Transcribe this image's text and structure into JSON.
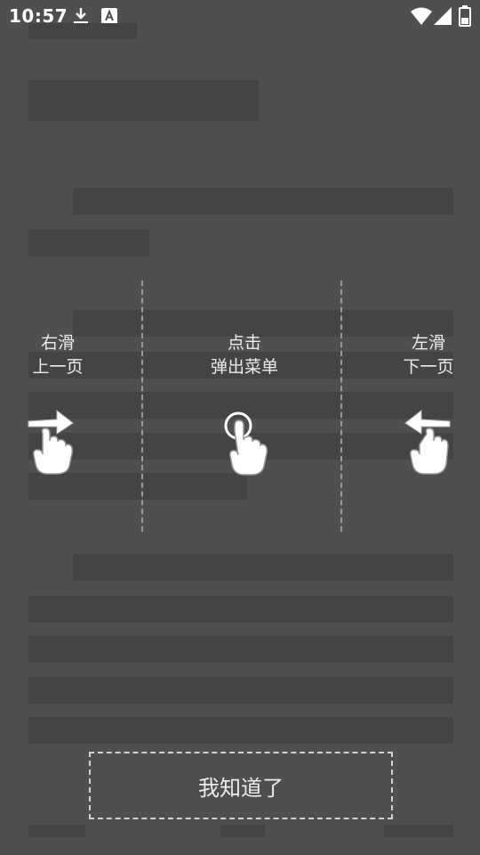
{
  "status_bar": {
    "time": "10:57"
  },
  "guide": {
    "left": {
      "line1": "右滑",
      "line2": "上一页"
    },
    "center": {
      "line1": "点击",
      "line2": "弹出菜单"
    },
    "right": {
      "line1": "左滑",
      "line2": "下一页"
    }
  },
  "confirm_button": {
    "label": "我知道了"
  }
}
